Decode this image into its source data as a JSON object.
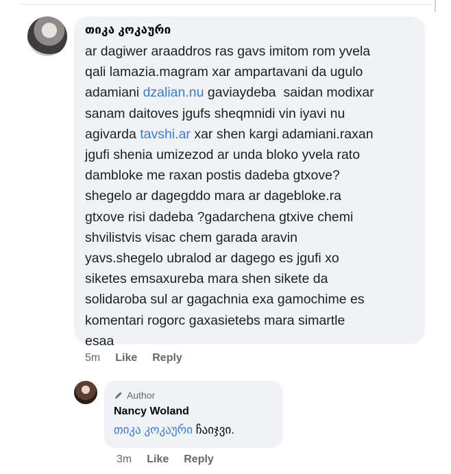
{
  "comment": {
    "author": "თიკა კოკაური",
    "text_parts": [
      {
        "text": "ar dagiwer araaddros ras gavs imitom rom yvela\nqali lamazia.magram xar ampartavani da ugulo\nadamiani ",
        "link": false
      },
      {
        "text": "dzalian.nu",
        "link": true
      },
      {
        "text": " gaviaydeba  saidan modixar\nsanam daitoves jgufs sheqmnidi vin iyavi nu\nagivarda ",
        "link": false
      },
      {
        "text": "tavshi.ar",
        "link": true
      },
      {
        "text": " xar shen kargi adamiani.raxan\njgufi shenia umizezod ar unda bloko yvela rato\ndambloke me raxan postis dadeba gtxove?\nshegelo ar dagegddo mara ar dagebloke.ra\ngtxove risi dadeba ?gadarchena gtxive chemi\nshvilistvis visac chem garada aravin\nyavs.shegelo ubralod ar dagego es jgufi xo\nsiketes emsaxureba mara shen sikete da\nsolidaroba sul ar gagachnia exa gamochime es\nkomentari rogorc gaxasietebs mara simartle\nesaa",
        "link": false
      }
    ],
    "time": "5m",
    "like_label": "Like",
    "reply_label": "Reply"
  },
  "reply": {
    "badge_label": "Author",
    "author": "Nancy Woland",
    "mention": "თიკა კოკაური",
    "text": " ჩაიჯვი.",
    "time": "3m",
    "like_label": "Like",
    "reply_label": "Reply",
    "icons": {
      "badge": "pen-icon"
    }
  },
  "colors": {
    "link": "#3b7bd1",
    "bubble": "#f0f2f5",
    "meta": "#65676b"
  }
}
